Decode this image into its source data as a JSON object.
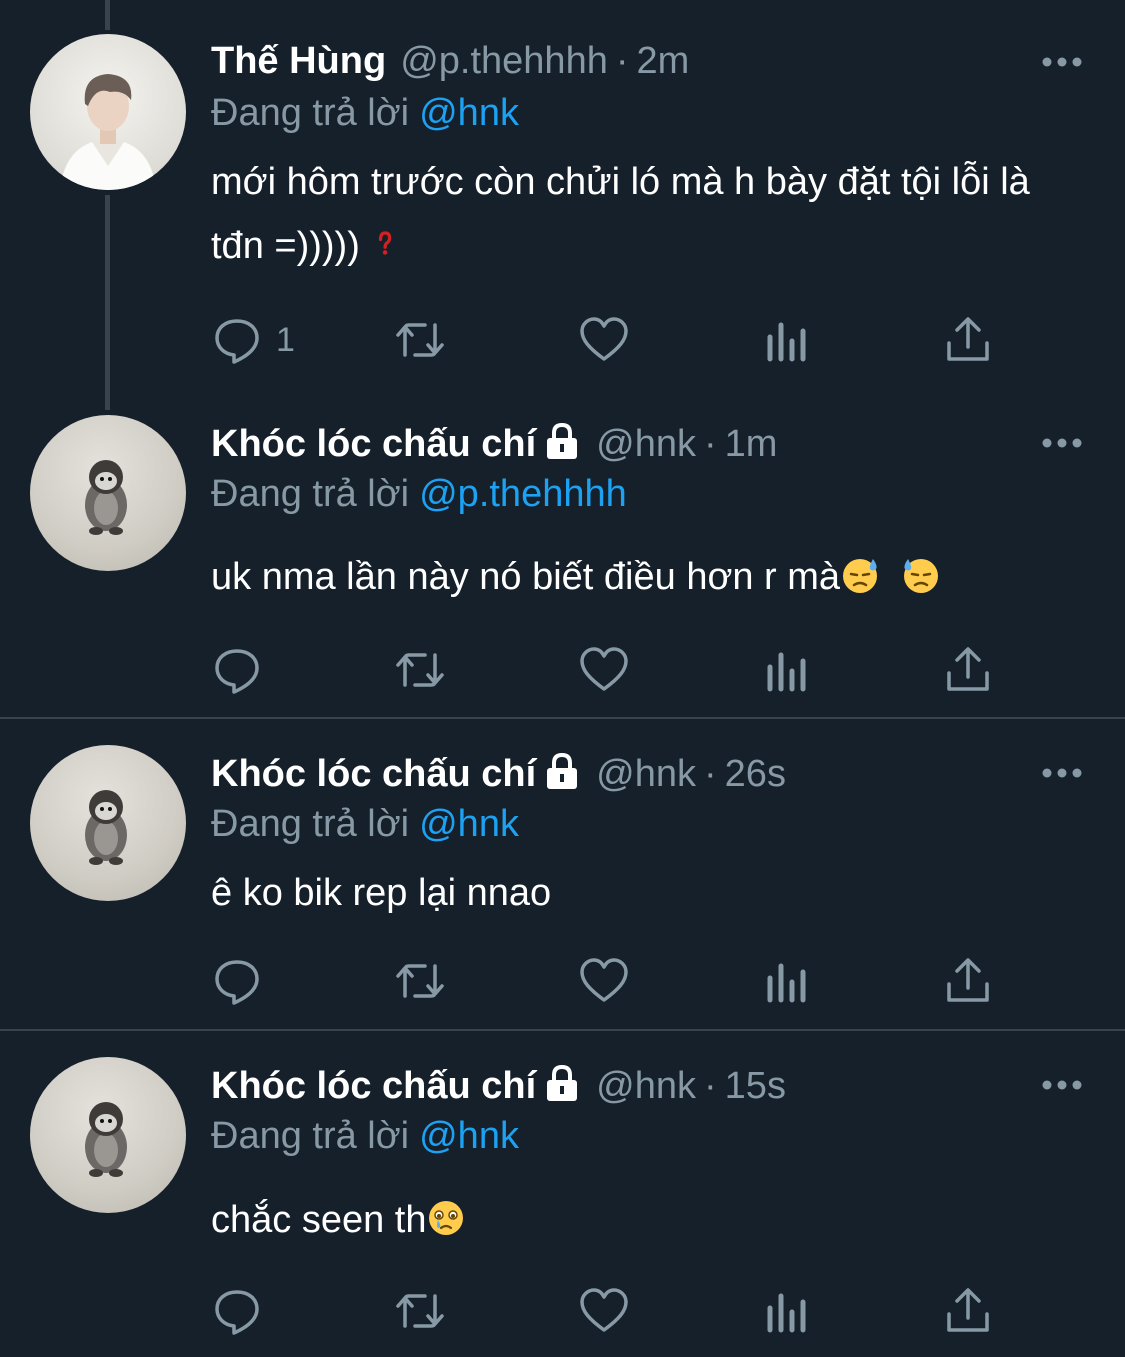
{
  "tweets": [
    {
      "name": "Thế Hùng",
      "handle": "@p.thehhhh",
      "separator": "·",
      "time": "2m",
      "replying_label": "Đang trả lời",
      "replying_to": "@hnk",
      "text": "mới hôm trước còn chửi ló mà h bày đặt tội lỗi là tđn =)))))",
      "emoji": "question-mark-emoji",
      "reply_count": "1",
      "locked": false
    },
    {
      "name": "Khóc lóc chấu chí",
      "handle": "@hnk",
      "separator": "·",
      "time": "1m",
      "replying_label": "Đang trả lời",
      "replying_to": "@p.thehhhh",
      "text": "uk nma lần này nó biết điều hơn r mà",
      "emoji": "sweat-face-emoji x2",
      "reply_count": "",
      "locked": true
    },
    {
      "name": "Khóc lóc chấu chí",
      "handle": "@hnk",
      "separator": "·",
      "time": "26s",
      "replying_label": "Đang trả lời",
      "replying_to": "@hnk",
      "text": "ê ko bik rep lại nnao",
      "emoji": "",
      "reply_count": "",
      "locked": true
    },
    {
      "name": "Khóc lóc chấu chí",
      "handle": "@hnk",
      "separator": "·",
      "time": "15s",
      "replying_label": "Đang trả lời",
      "replying_to": "@hnk",
      "text": "chắc seen th",
      "emoji": "holding-back-tears-emoji",
      "reply_count": "",
      "locked": true
    }
  ],
  "icons": [
    "reply-icon",
    "retweet-icon",
    "like-icon",
    "analytics-icon",
    "share-icon",
    "more-icon",
    "lock-icon"
  ],
  "colors": {
    "background": "#15202b",
    "text_primary": "#ffffff",
    "text_secondary": "#8899a6",
    "mention": "#1da1f2",
    "divider": "#38444d"
  }
}
